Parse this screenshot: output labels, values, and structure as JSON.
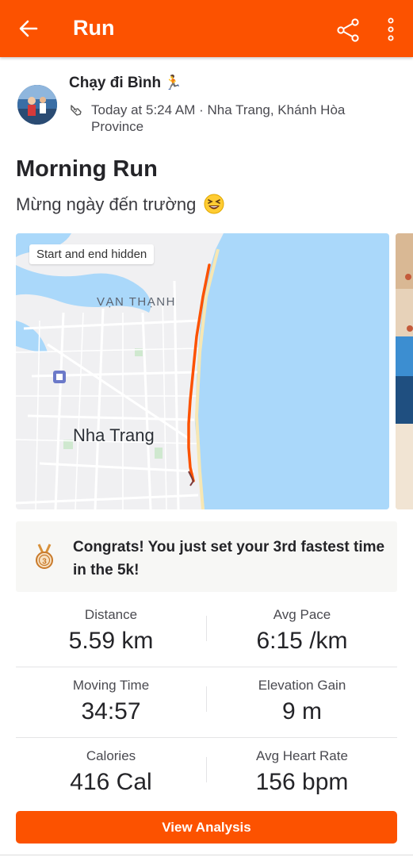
{
  "app_bar": {
    "title": "Run",
    "back_icon": "arrow-left-icon",
    "share_icon": "share-icon",
    "more_icon": "more-vertical-icon"
  },
  "athlete": {
    "name": "Chạy đi Bình",
    "name_emoji": "runner-emoji",
    "meta_icon": "shoe-icon",
    "meta": "Today at 5:24 AM · Nha Trang, Khánh Hòa Province"
  },
  "activity": {
    "title": "Morning Run",
    "description": "Mừng ngày đến trường",
    "description_emoji": "grinning-squinting-face"
  },
  "map": {
    "pill": "Start and end hidden",
    "district": "VẠN THẠNH",
    "city": "Nha Trang",
    "route_color": "#fc5200"
  },
  "congrats": {
    "icon": "medal-3rd-icon",
    "text": "Congrats! You just set your 3rd fastest time in the 5k!"
  },
  "stats": [
    [
      {
        "label": "Distance",
        "value": "5.59 km"
      },
      {
        "label": "Avg Pace",
        "value": "6:15 /km"
      }
    ],
    [
      {
        "label": "Moving Time",
        "value": "34:57"
      },
      {
        "label": "Elevation Gain",
        "value": "9 m"
      }
    ],
    [
      {
        "label": "Calories",
        "value": "416 Cal"
      },
      {
        "label": "Avg Heart Rate",
        "value": "156 bpm"
      }
    ]
  ],
  "actions": {
    "view_analysis": "View Analysis"
  },
  "colors": {
    "brand": "#fc5200",
    "water": "#aad8fa",
    "land": "#f0f0f2"
  }
}
